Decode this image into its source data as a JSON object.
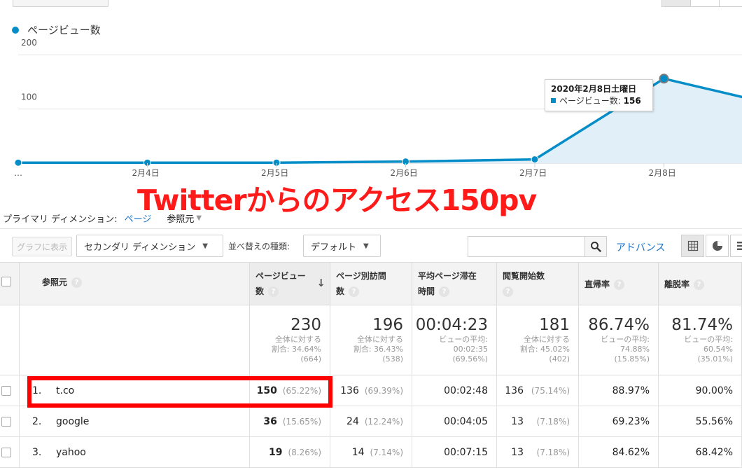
{
  "legend": {
    "label": "ページビュー数",
    "color": "#058dc7"
  },
  "chart_data": {
    "type": "area",
    "series": [
      {
        "name": "ページビュー数",
        "values": [
          1,
          1,
          1,
          3,
          7,
          156,
          100
        ]
      }
    ],
    "x_tick_labels": [
      "…",
      "2月4日",
      "2月5日",
      "2月6日",
      "2月7日",
      "2月8日"
    ],
    "y_tick_labels": [
      "200",
      "100"
    ],
    "ylim": [
      0,
      230
    ],
    "color": "#058dc7",
    "fill": "#e1eff8"
  },
  "tooltip": {
    "title": "2020年2月8日土曜日",
    "series_label": "ページビュー数:",
    "value": "156"
  },
  "overlay_text": "Twitterからのアクセス150pv",
  "primary_dimension": {
    "label": "プライマリ ディメンション:",
    "link": "ページ",
    "current": "参照元"
  },
  "toolbar": {
    "graph_button": "グラフに表示",
    "secondary_dimension": "セカンダリ ディメンション",
    "sort_label": "並べ替えの種類:",
    "sort_value": "デフォルト",
    "advanced": "アドバンス"
  },
  "table": {
    "headers": {
      "source": "参照元",
      "pageviews_1": "ページビュー",
      "pageviews_2": "数",
      "unique_1": "ページ別訪問",
      "unique_2": "数",
      "avg_time_1": "平均ページ滞在",
      "avg_time_2": "時間",
      "entrances": "閲覧開始数",
      "bounce": "直帰率",
      "exit": "離脱率"
    },
    "totals": {
      "pageviews": {
        "value": "230",
        "line1": "全体に対する",
        "line2": "割合: 34.64%",
        "line3": "(664)"
      },
      "unique": {
        "value": "196",
        "line1": "全体に対する",
        "line2": "割合: 36.43%",
        "line3": "(538)"
      },
      "avg_time": {
        "value": "00:04:23",
        "line1": "ビューの平均:",
        "line2": "00:02:35",
        "line3": "(69.56%)"
      },
      "entrances": {
        "value": "181",
        "line1": "全体に対する",
        "line2": "割合: 45.02%",
        "line3": "(402)"
      },
      "bounce": {
        "value": "86.74%",
        "line1": "ビューの平均:",
        "line2": "74.88%",
        "line3": "(15.85%)"
      },
      "exit": {
        "value": "81.74%",
        "line1": "ビューの平均:",
        "line2": "60.54%",
        "line3": "(35.01%)"
      }
    },
    "rows": [
      {
        "num": "1.",
        "source": "t.co",
        "pageviews": "150",
        "pageviews_pct": "(65.22%)",
        "unique": "136",
        "unique_pct": "(69.39%)",
        "avg_time": "00:02:48",
        "entrances": "136",
        "entrances_pct": "(75.14%)",
        "bounce": "88.97%",
        "exit": "90.00%"
      },
      {
        "num": "2.",
        "source": "google",
        "pageviews": "36",
        "pageviews_pct": "(15.65%)",
        "unique": "24",
        "unique_pct": "(12.24%)",
        "avg_time": "00:04:05",
        "entrances": "13",
        "entrances_pct": "(7.18%)",
        "bounce": "69.23%",
        "exit": "55.56%"
      },
      {
        "num": "3.",
        "source": "yahoo",
        "pageviews": "19",
        "pageviews_pct": "(8.26%)",
        "unique": "14",
        "unique_pct": "(7.14%)",
        "avg_time": "00:07:15",
        "entrances": "13",
        "entrances_pct": "(7.18%)",
        "bounce": "84.62%",
        "exit": "68.42%"
      }
    ]
  }
}
